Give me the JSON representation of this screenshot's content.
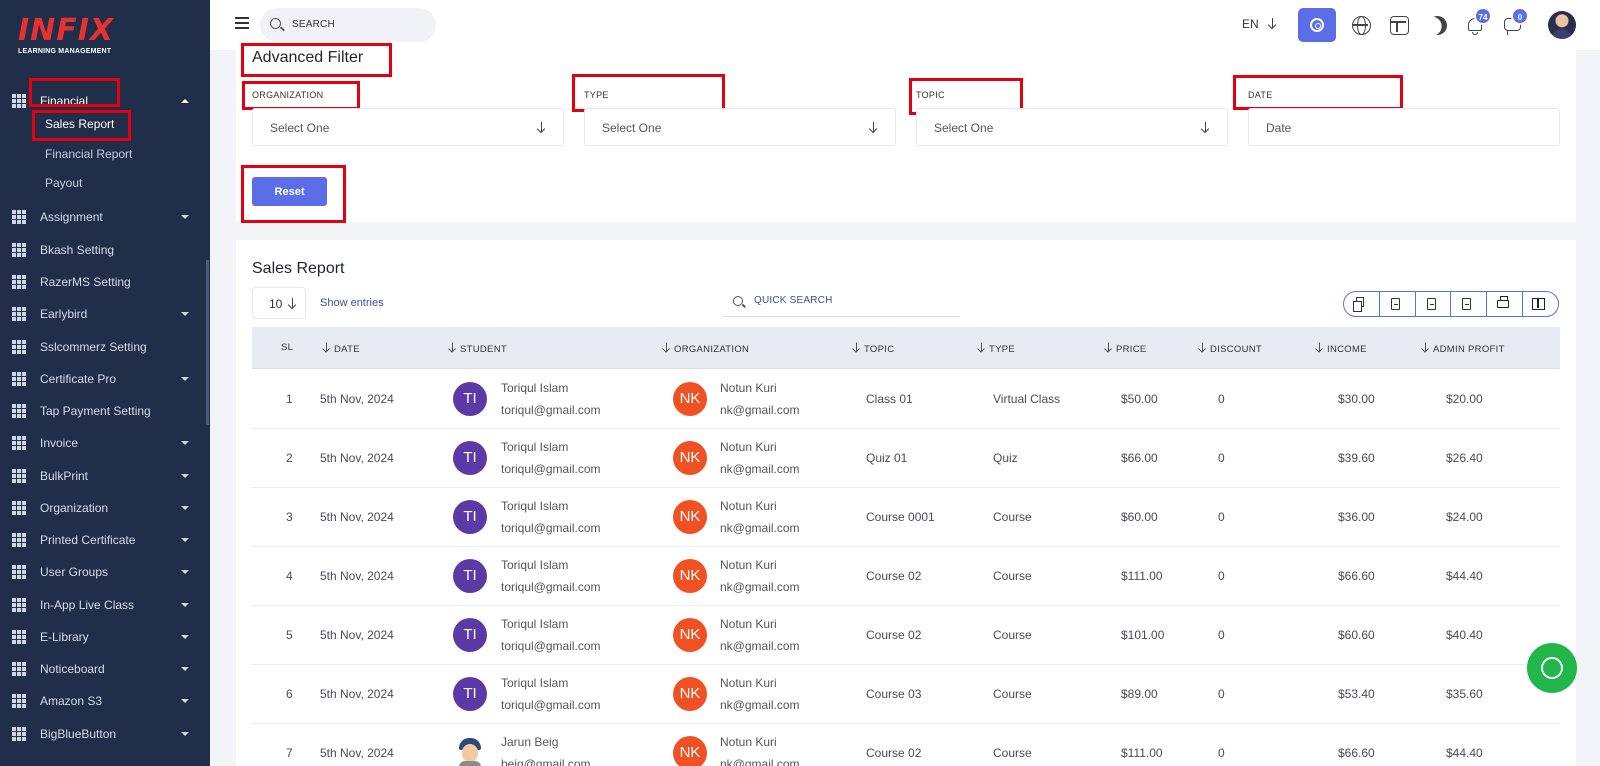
{
  "logo": {
    "text": "INFIX",
    "sub": "LEARNING MANAGEMENT"
  },
  "sidebar": {
    "financial": "Financial",
    "sub_items": [
      "Sales Report",
      "Financial Report",
      "Payout"
    ],
    "items": [
      {
        "label": "Assignment",
        "caret": true
      },
      {
        "label": "Bkash Setting",
        "caret": false
      },
      {
        "label": "RazerMS Setting",
        "caret": false
      },
      {
        "label": "Earlybird",
        "caret": true
      },
      {
        "label": "Sslcommerz Setting",
        "caret": false
      },
      {
        "label": "Certificate Pro",
        "caret": true
      },
      {
        "label": "Tap Payment Setting",
        "caret": false
      },
      {
        "label": "Invoice",
        "caret": true
      },
      {
        "label": "BulkPrint",
        "caret": true
      },
      {
        "label": "Organization",
        "caret": true
      },
      {
        "label": "Printed Certificate",
        "caret": true
      },
      {
        "label": "User Groups",
        "caret": true
      },
      {
        "label": "In-App Live Class",
        "caret": true
      },
      {
        "label": "E-Library",
        "caret": true
      },
      {
        "label": "Noticeboard",
        "caret": true
      },
      {
        "label": "Amazon S3",
        "caret": true
      },
      {
        "label": "BigBlueButton",
        "caret": true
      }
    ]
  },
  "topbar": {
    "search_placeholder": "SEARCH",
    "lang": "EN",
    "notif_count": "74",
    "chat_count": "0"
  },
  "filter": {
    "title": "Advanced Filter",
    "labels": [
      "ORGANIZATION",
      "TYPE",
      "TOPIC",
      "DATE"
    ],
    "placeholders": [
      "Select One",
      "Select One",
      "Select One",
      "Date"
    ],
    "reset": "Reset"
  },
  "report": {
    "title": "Sales Report",
    "per_page": "10",
    "show_entries": "Show entries",
    "quick_search": "QUICK SEARCH",
    "columns": [
      "SL",
      "DATE",
      "STUDENT",
      "ORGANIZATION",
      "TOPIC",
      "TYPE",
      "PRICE",
      "DISCOUNT",
      "INCOME",
      "ADMIN PROFIT"
    ],
    "rows": [
      {
        "sl": "1",
        "date": "5th Nov, 2024",
        "s_init": "TI",
        "s_name": "Toriqul Islam",
        "s_email": "toriqul@gmail.com",
        "o_init": "NK",
        "o_name": "Notun Kuri",
        "o_email": "nk@gmail.com",
        "topic": "Class 01",
        "type": "Virtual Class",
        "price": "$50.00",
        "discount": "0",
        "income": "$30.00",
        "profit": "$20.00"
      },
      {
        "sl": "2",
        "date": "5th Nov, 2024",
        "s_init": "TI",
        "s_name": "Toriqul Islam",
        "s_email": "toriqul@gmail.com",
        "o_init": "NK",
        "o_name": "Notun Kuri",
        "o_email": "nk@gmail.com",
        "topic": "Quiz 01",
        "type": "Quiz",
        "price": "$66.00",
        "discount": "0",
        "income": "$39.60",
        "profit": "$26.40"
      },
      {
        "sl": "3",
        "date": "5th Nov, 2024",
        "s_init": "TI",
        "s_name": "Toriqul Islam",
        "s_email": "toriqul@gmail.com",
        "o_init": "NK",
        "o_name": "Notun Kuri",
        "o_email": "nk@gmail.com",
        "topic": "Course 0001",
        "type": "Course",
        "price": "$60.00",
        "discount": "0",
        "income": "$36.00",
        "profit": "$24.00"
      },
      {
        "sl": "4",
        "date": "5th Nov, 2024",
        "s_init": "TI",
        "s_name": "Toriqul Islam",
        "s_email": "toriqul@gmail.com",
        "o_init": "NK",
        "o_name": "Notun Kuri",
        "o_email": "nk@gmail.com",
        "topic": "Course 02",
        "type": "Course",
        "price": "$111.00",
        "discount": "0",
        "income": "$66.60",
        "profit": "$44.40"
      },
      {
        "sl": "5",
        "date": "5th Nov, 2024",
        "s_init": "TI",
        "s_name": "Toriqul Islam",
        "s_email": "toriqul@gmail.com",
        "o_init": "NK",
        "o_name": "Notun Kuri",
        "o_email": "nk@gmail.com",
        "topic": "Course 02",
        "type": "Course",
        "price": "$101.00",
        "discount": "0",
        "income": "$60.60",
        "profit": "$40.40"
      },
      {
        "sl": "6",
        "date": "5th Nov, 2024",
        "s_init": "TI",
        "s_name": "Toriqul Islam",
        "s_email": "toriqul@gmail.com",
        "o_init": "NK",
        "o_name": "Notun Kuri",
        "o_email": "nk@gmail.com",
        "topic": "Course 03",
        "type": "Course",
        "price": "$89.00",
        "discount": "0",
        "income": "$53.40",
        "profit": "$35.60"
      },
      {
        "sl": "7",
        "date": "5th Nov, 2024",
        "s_init": "",
        "s_name": "Jarun Beig",
        "s_email": "beig@gmail.com",
        "o_init": "NK",
        "o_name": "Notun Kuri",
        "o_email": "nk@gmail.com",
        "topic": "Course 02",
        "type": "Course",
        "price": "$111.00",
        "discount": "0",
        "income": "$66.60",
        "profit": "$44.40"
      }
    ]
  },
  "colors": {
    "sidebar": "#202e4a",
    "accent": "#5b6ee8",
    "highlight": "#e3000f",
    "avatar_ti": "#5c3aa6",
    "avatar_nk": "#f05123",
    "whatsapp": "#21b74a"
  }
}
